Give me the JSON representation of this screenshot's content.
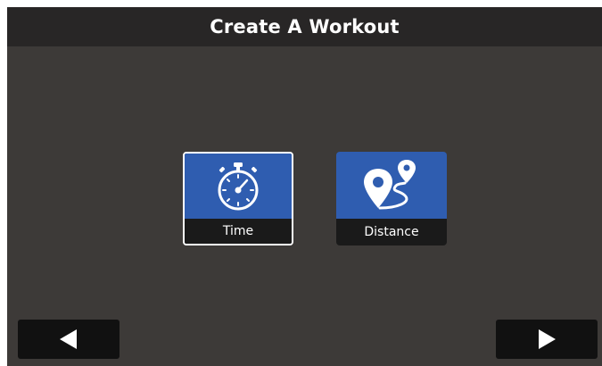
{
  "header": {
    "title": "Create A Workout"
  },
  "options": [
    {
      "label": "Time",
      "icon": "stopwatch-icon",
      "selected": true
    },
    {
      "label": "Distance",
      "icon": "map-route-icon",
      "selected": false
    }
  ],
  "navigation": {
    "back_icon": "triangle-left-icon",
    "next_icon": "triangle-right-icon"
  },
  "colors": {
    "background": "#3d3a38",
    "title_bar": "#282626",
    "tile_blue": "#2f5db0",
    "label_bar": "#1a1a1a",
    "button": "#111111"
  }
}
